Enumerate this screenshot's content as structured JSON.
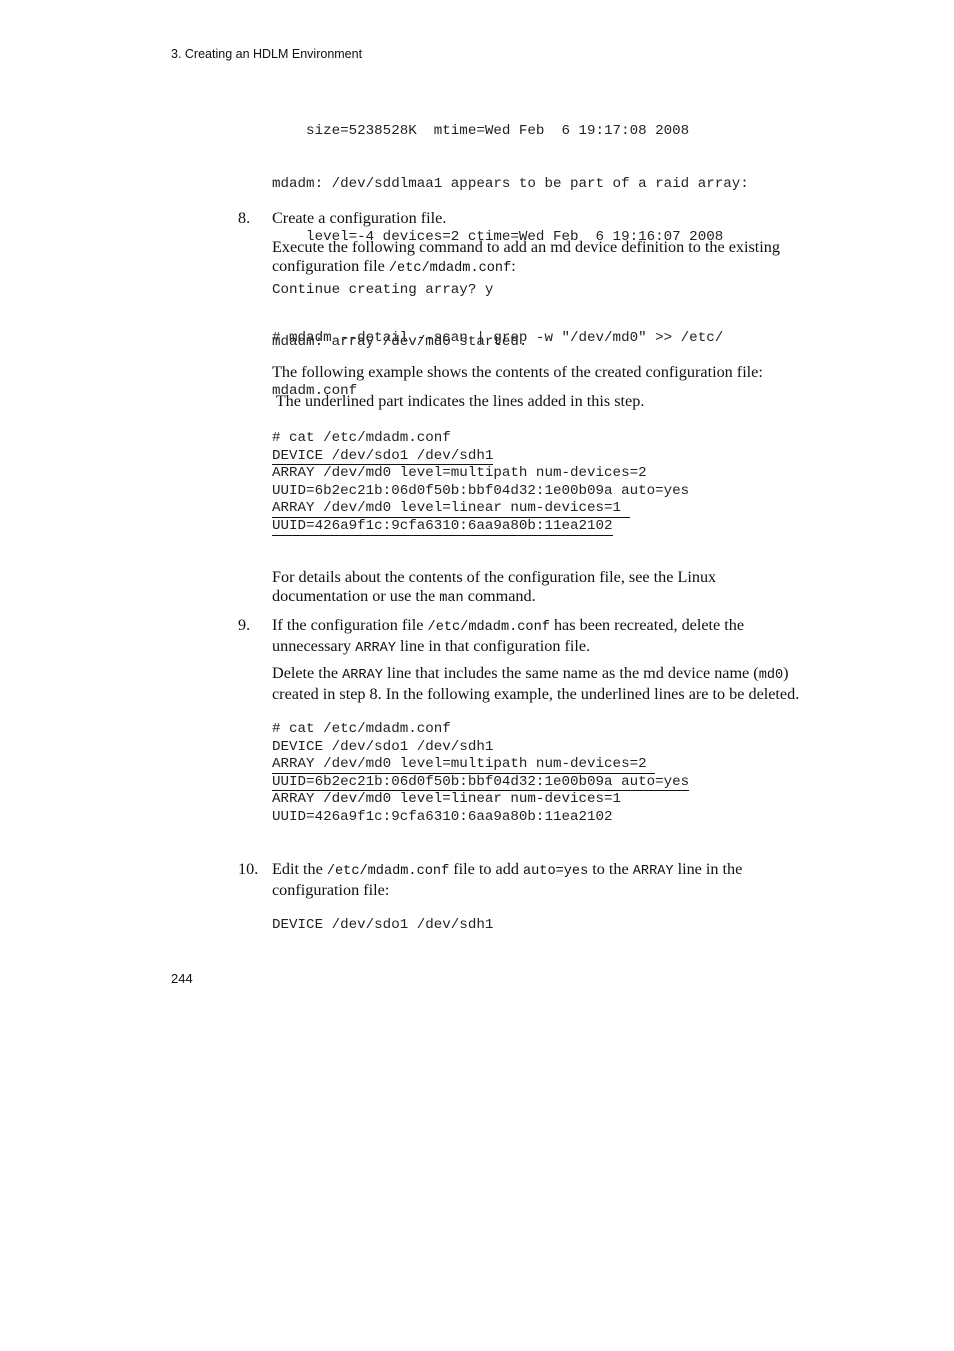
{
  "header": {
    "running_title": "3. Creating an HDLM Environment"
  },
  "top_code": [
    "    size=5238528K  mtime=Wed Feb  6 19:17:08 2008",
    "mdadm: /dev/sddlmaa1 appears to be part of a raid array:",
    "    level=-4 devices=2 ctime=Wed Feb  6 19:16:07 2008",
    "Continue creating array? y",
    "mdadm: array /dev/md0 started."
  ],
  "step8": {
    "number": "8.",
    "title": "Create a configuration file.",
    "intro_a": "Execute the following command to add an md device definition to the existing",
    "intro_b": "configuration file ",
    "intro_code": "/etc/mdadm.conf",
    "intro_c": ":",
    "command": [
      "# mdadm --detail --scan | grep -w \"/dev/md0\" >> /etc/",
      "mdadm.conf"
    ],
    "example_intro": "The following example shows the contents of the created configuration file:",
    "underline_note": " The underlined part indicates the lines added in this step.",
    "example_code": [
      {
        "text": "# cat /etc/mdadm.conf",
        "underlined": false
      },
      {
        "text": "DEVICE /dev/sdo1 /dev/sdh1",
        "underlined": true
      },
      {
        "text": "ARRAY /dev/md0 level=multipath num-devices=2",
        "underlined": false
      },
      {
        "text": "UUID=6b2ec21b:06d0f50b:bbf04d32:1e00b09a auto=yes",
        "underlined": false
      },
      {
        "text": "ARRAY /dev/md0 level=linear num-devices=1 ",
        "underlined": true
      },
      {
        "text": "UUID=426a9f1c:9cfa6310:6aa9a80b:11ea2102",
        "underlined": true
      }
    ],
    "details_a": "For details about the contents of the configuration file, see the Linux",
    "details_b": "documentation or use the ",
    "details_code": "man",
    "details_c": " command."
  },
  "step9": {
    "number": "9.",
    "line1_a": "If the configuration file ",
    "line1_code": "/etc/mdadm.conf",
    "line1_b": " has been recreated, delete the",
    "line2_a": "unnecessary ",
    "line2_code": "ARRAY",
    "line2_b": " line in that configuration file.",
    "para_a": "Delete the ",
    "para_code1": "ARRAY",
    "para_b": " line that includes the same name as the md device name (",
    "para_code2": "md0",
    "para_c": ")",
    "para_line2": "created in step 8. In the following example, the underlined lines are to be deleted.",
    "example_code": [
      {
        "text": "# cat /etc/mdadm.conf",
        "underlined": false
      },
      {
        "text": "DEVICE /dev/sdo1 /dev/sdh1",
        "underlined": false
      },
      {
        "text": "ARRAY /dev/md0 level=multipath num-devices=2 ",
        "underlined": true
      },
      {
        "text": "UUID=6b2ec21b:06d0f50b:bbf04d32:1e00b09a auto=yes",
        "underlined": true
      },
      {
        "text": "ARRAY /dev/md0 level=linear num-devices=1",
        "underlined": false
      },
      {
        "text": "UUID=426a9f1c:9cfa6310:6aa9a80b:11ea2102",
        "underlined": false
      }
    ]
  },
  "step10": {
    "number": "10.",
    "a": "Edit the ",
    "code1": "/etc/mdadm.conf",
    "b": " file to add ",
    "code2": "auto=yes",
    "c": " to the ",
    "code3": "ARRAY",
    "d": " line in the",
    "line2": "configuration file:",
    "code": "DEVICE /dev/sdo1 /dev/sdh1"
  },
  "footer": {
    "page_number": "244"
  }
}
